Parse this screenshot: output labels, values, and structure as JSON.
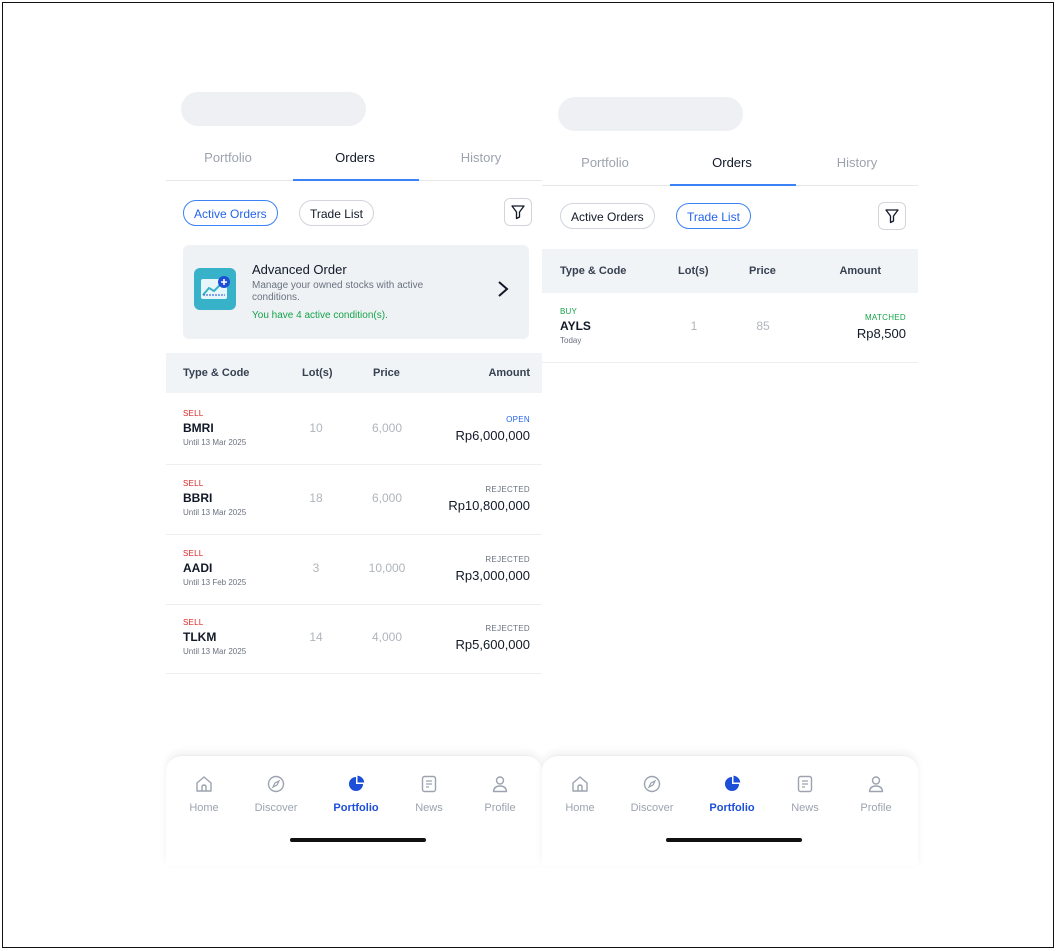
{
  "tabs": [
    "Portfolio",
    "Orders",
    "History"
  ],
  "filters": [
    "Active Orders",
    "Trade List"
  ],
  "advanced_order": {
    "title": "Advanced Order",
    "description": "Manage your owned stocks with active conditions.",
    "active_text": "You have 4 active condition(s)."
  },
  "table_headers": [
    "Type & Code",
    "Lot(s)",
    "Price",
    "Amount"
  ],
  "active_orders": [
    {
      "side": "SELL",
      "code": "BMRI",
      "until": "Until 13 Mar 2025",
      "lots": "10",
      "price": "6,000",
      "status": "OPEN",
      "amount": "Rp6,000,000"
    },
    {
      "side": "SELL",
      "code": "BBRI",
      "until": "Until 13 Mar 2025",
      "lots": "18",
      "price": "6,000",
      "status": "REJECTED",
      "amount": "Rp10,800,000"
    },
    {
      "side": "SELL",
      "code": "AADI",
      "until": "Until 13 Feb 2025",
      "lots": "3",
      "price": "10,000",
      "status": "REJECTED",
      "amount": "Rp3,000,000"
    },
    {
      "side": "SELL",
      "code": "TLKM",
      "until": "Until 13 Mar 2025",
      "lots": "14",
      "price": "4,000",
      "status": "REJECTED",
      "amount": "Rp5,600,000"
    }
  ],
  "trade_list": [
    {
      "side": "BUY",
      "code": "AYLS",
      "until": "Today",
      "lots": "1",
      "price": "85",
      "status": "MATCHED",
      "amount": "Rp8,500"
    }
  ],
  "nav": [
    "Home",
    "Discover",
    "Portfolio",
    "News",
    "Profile"
  ],
  "icons": {
    "nav": [
      "home-icon",
      "compass-icon",
      "pie-chart-icon",
      "news-icon",
      "profile-icon"
    ],
    "filter": "filter-icon",
    "advanced": "chart-plus-icon",
    "chevron": "chevron-right-icon"
  },
  "colors": {
    "accent": "#2563eb",
    "sell": "#dc2626",
    "buy": "#16a34a",
    "advanced_icon_bg": "#38b2c8"
  }
}
